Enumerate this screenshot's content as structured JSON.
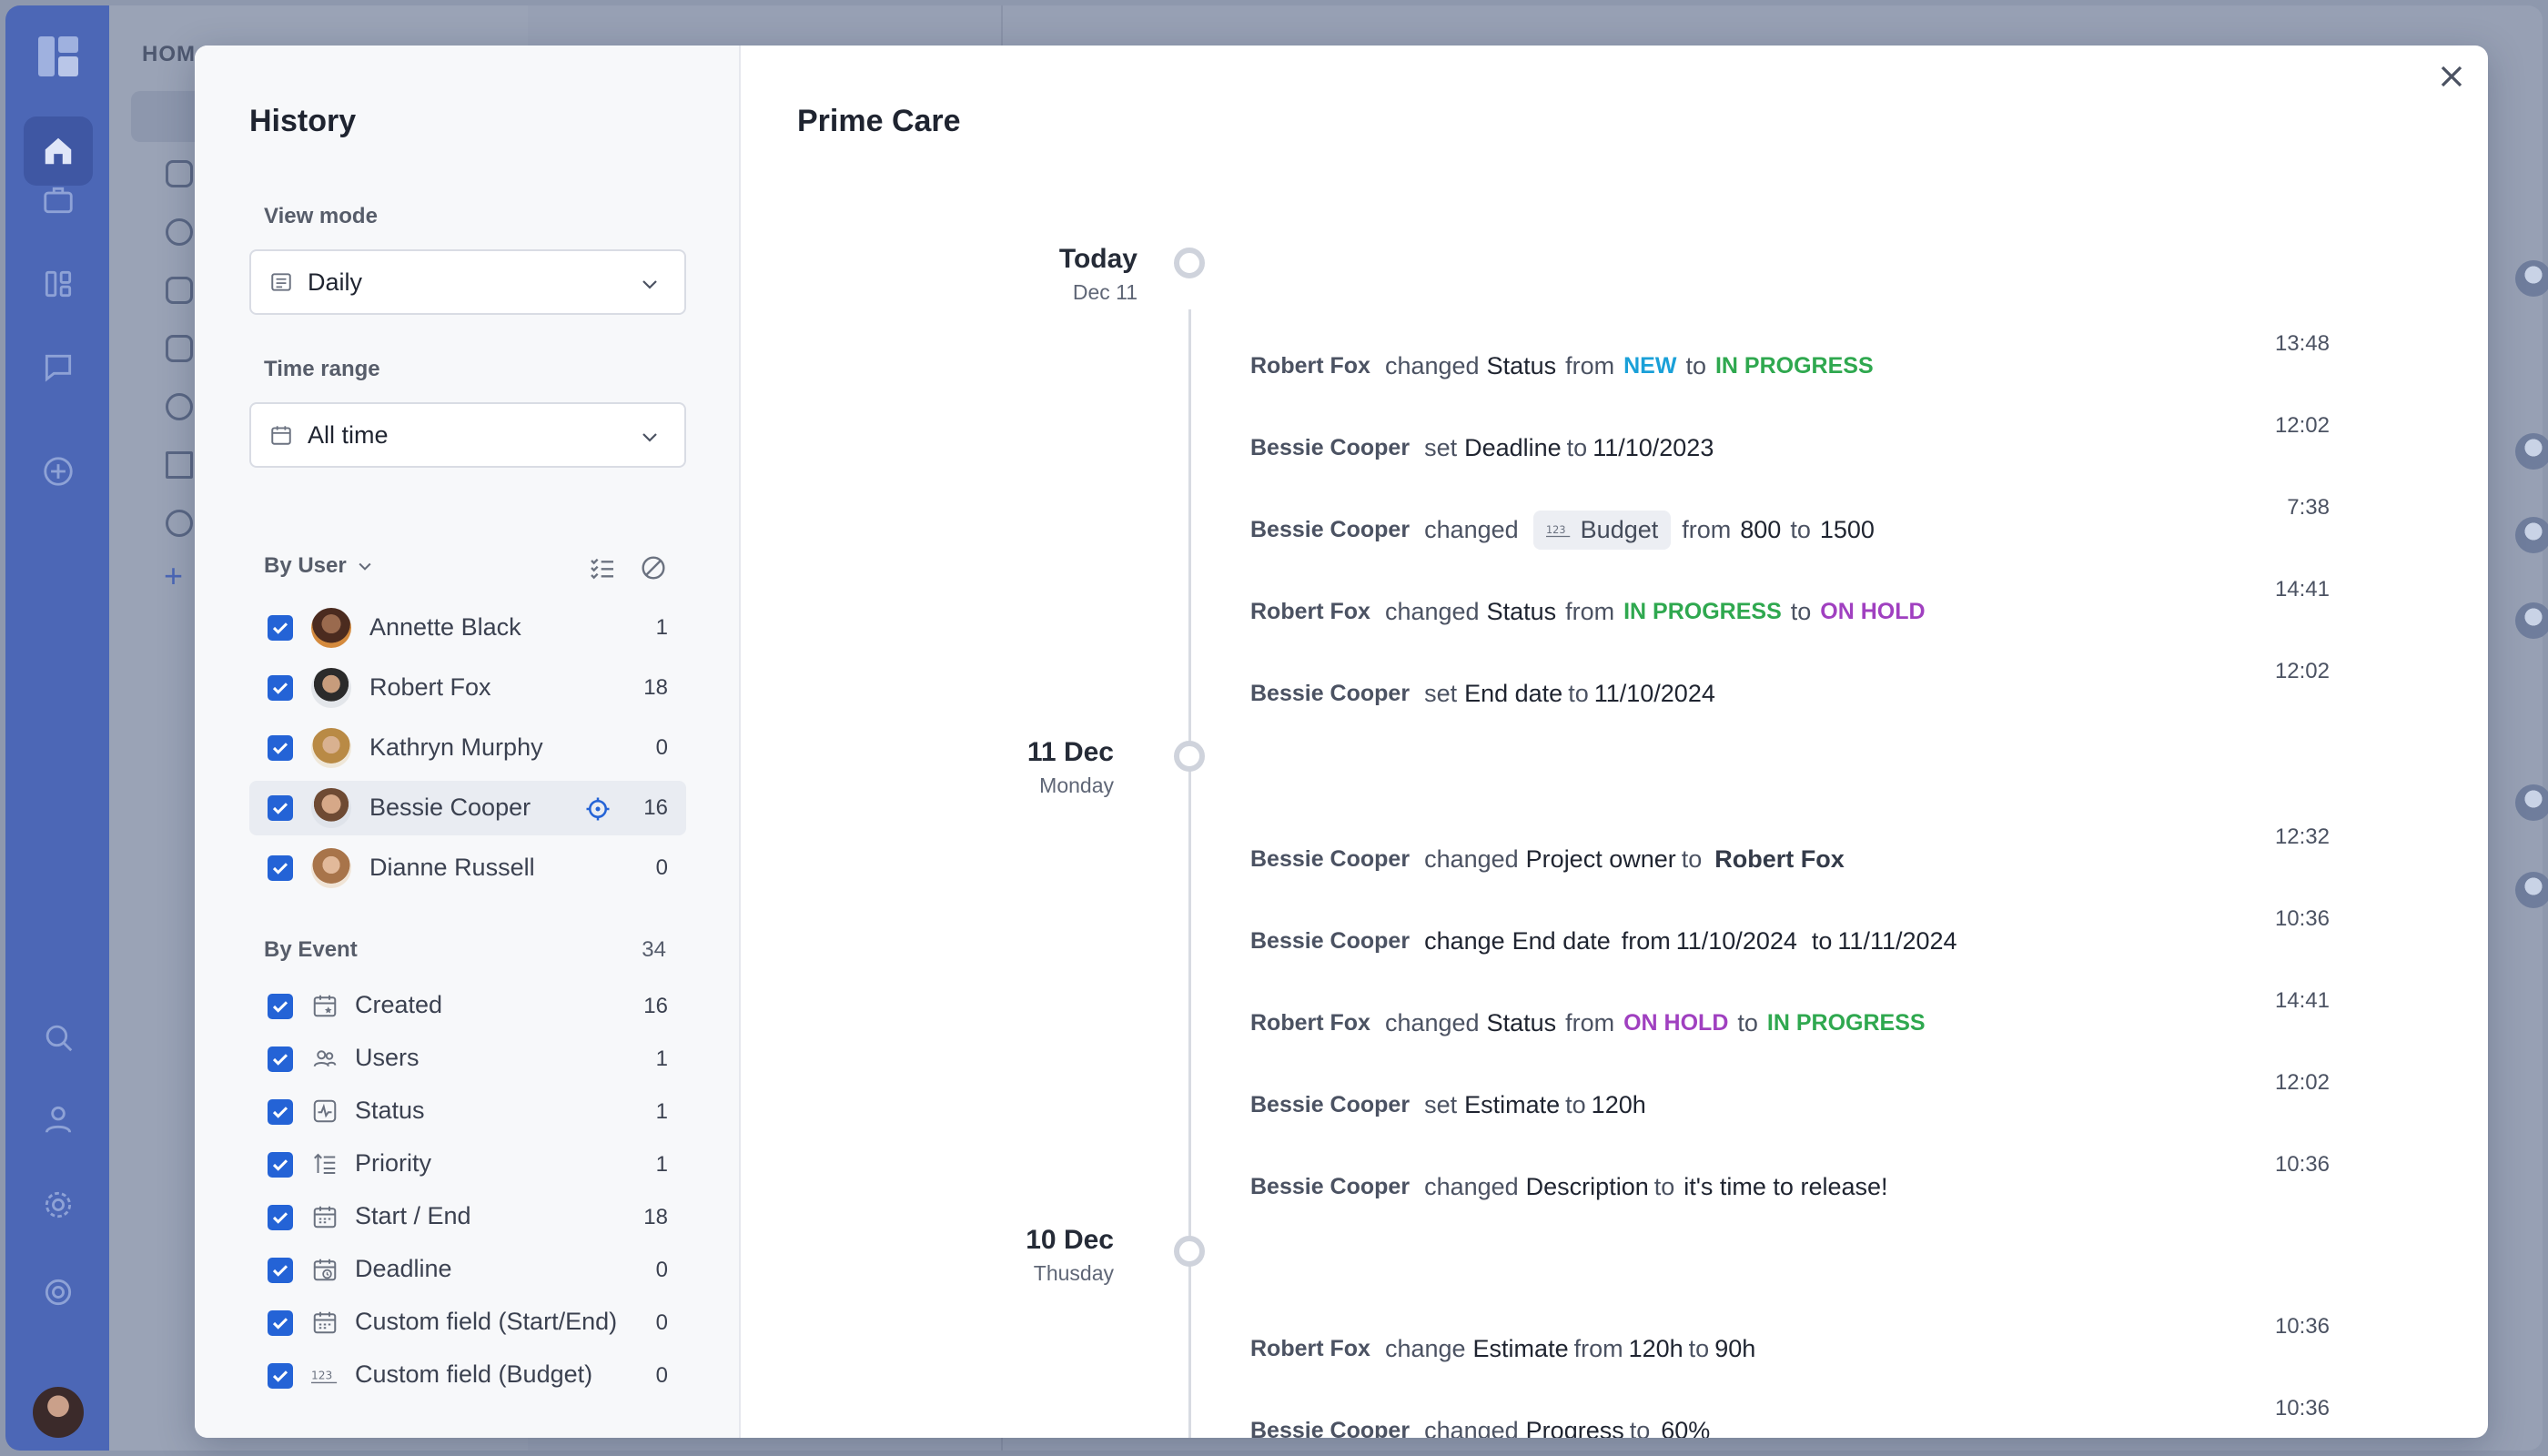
{
  "background": {
    "home_label": "HOM"
  },
  "modal": {
    "left_title": "History",
    "right_title": "Prime Care",
    "close_icon": "close-icon"
  },
  "view_mode": {
    "label": "View mode",
    "value": "Daily"
  },
  "time_range": {
    "label": "Time range",
    "value": "All time"
  },
  "by_user": {
    "label": "By User",
    "users": [
      {
        "name": "Annette Black",
        "count": "1"
      },
      {
        "name": "Robert Fox",
        "count": "18"
      },
      {
        "name": "Kathryn Murphy",
        "count": "0"
      },
      {
        "name": "Bessie Cooper",
        "count": "16"
      },
      {
        "name": "Dianne Russell",
        "count": "0"
      }
    ]
  },
  "by_event": {
    "label": "By Event",
    "total": "34",
    "events": [
      {
        "name": "Created",
        "count": "16",
        "icon": "calendar-star-icon"
      },
      {
        "name": "Users",
        "count": "1",
        "icon": "users-icon"
      },
      {
        "name": "Status",
        "count": "1",
        "icon": "activity-icon"
      },
      {
        "name": "Priority",
        "count": "1",
        "icon": "priority-icon"
      },
      {
        "name": "Start / End",
        "count": "18",
        "icon": "calendar-icon"
      },
      {
        "name": "Deadline",
        "count": "0",
        "icon": "deadline-icon"
      },
      {
        "name": "Custom field (Start/End)",
        "count": "0",
        "icon": "calendar-icon"
      },
      {
        "name": "Custom field (Budget)",
        "count": "0",
        "icon": "number-icon"
      }
    ]
  },
  "timeline": {
    "groups": [
      {
        "day": "Today",
        "sub": "Dec 11"
      },
      {
        "day": "11 Dec",
        "sub": "Monday"
      },
      {
        "day": "10 Dec",
        "sub": "Thusday"
      }
    ],
    "entries": [
      {
        "who": "Robert Fox",
        "verb": "changed",
        "field": "Status",
        "from_word": "from",
        "from": "NEW",
        "to_word": "to",
        "to": "IN PROGRESS",
        "time": "13:48"
      },
      {
        "who": "Bessie Cooper",
        "verb": "set",
        "field": "Deadline",
        "to_word": "to",
        "to": "11/10/2023",
        "time": "12:02"
      },
      {
        "who": "Bessie Cooper",
        "verb": "changed",
        "field": "Budget",
        "from_word": "from",
        "from": "800",
        "to_word": "to",
        "to": "1500",
        "time": "7:38"
      },
      {
        "who": "Robert Fox",
        "verb": "changed",
        "field": "Status",
        "from_word": "from",
        "from": "IN PROGRESS",
        "to_word": "to",
        "to": "ON HOLD",
        "time": "14:41"
      },
      {
        "who": "Bessie Cooper",
        "verb": "set",
        "field": "End date",
        "to_word": "to",
        "to": "11/10/2024",
        "time": "12:02"
      },
      {
        "who": "Bessie Cooper",
        "verb": "changed",
        "field": "Project owner",
        "to_word": "to",
        "to": "Robert Fox",
        "time": "12:32"
      },
      {
        "who": "Bessie Cooper",
        "verb": "change",
        "field": "End date",
        "from_word": "from",
        "from": "11/10/2024",
        "to_word": "to",
        "to": "11/11/2024",
        "time": "10:36"
      },
      {
        "who": "Robert Fox",
        "verb": "changed",
        "field": "Status",
        "from_word": "from",
        "from": "ON HOLD",
        "to_word": "to",
        "to": "IN PROGRESS",
        "time": "14:41"
      },
      {
        "who": "Bessie Cooper",
        "verb": "set",
        "field": "Estimate",
        "to_word": "to",
        "to": "120h",
        "time": "12:02"
      },
      {
        "who": "Bessie Cooper",
        "verb": "changed",
        "field": "Description",
        "to_word": "to",
        "to": "it's time to release!",
        "time": "10:36"
      },
      {
        "who": "Robert Fox",
        "verb": "change",
        "field": "Estimate",
        "from_word": "from",
        "from": "120h",
        "to_word": "to",
        "to": "90h",
        "time": "10:36"
      },
      {
        "who": "Bessie Cooper",
        "verb": "changed",
        "field": "Progress",
        "to_word": "to",
        "to": "60%",
        "time": "10:36"
      }
    ]
  },
  "colors": {
    "accent": "#2463d6",
    "status_new": "#1aa0d8",
    "status_in_progress": "#2fa84f",
    "status_on_hold": "#a040c0"
  }
}
